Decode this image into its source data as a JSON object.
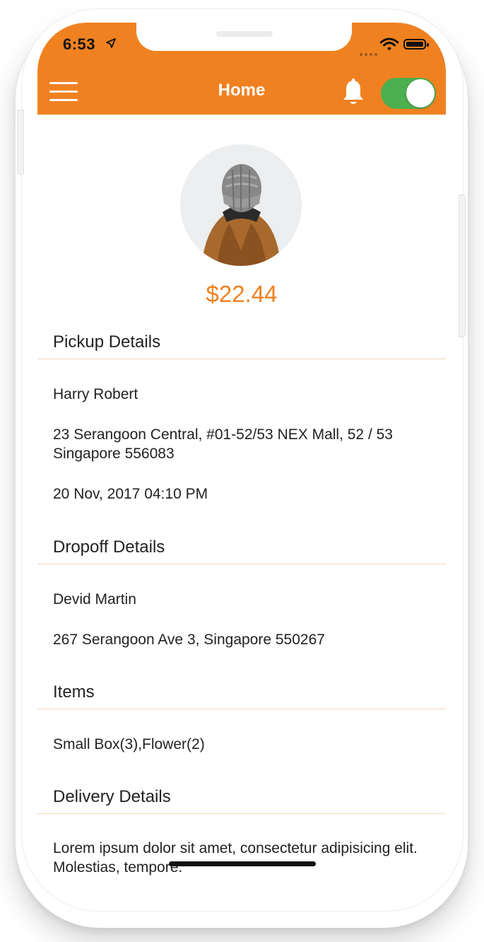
{
  "status_bar": {
    "time": "6:53"
  },
  "header": {
    "title": "Home",
    "toggle_on": true
  },
  "profile": {
    "price": "$22.44"
  },
  "pickup": {
    "heading": "Pickup Details",
    "name": "Harry Robert",
    "address": "23 Serangoon Central, #01-52/53 NEX Mall, 52 / 53 Singapore 556083",
    "datetime": "20 Nov, 2017 04:10 PM"
  },
  "dropoff": {
    "heading": "Dropoff Details",
    "name": "Devid Martin",
    "address": "267 Serangoon Ave 3, Singapore 550267"
  },
  "items": {
    "heading": "Items",
    "list": "Small Box(3),Flower(2)"
  },
  "delivery": {
    "heading": "Delivery Details",
    "text": "Lorem ipsum dolor sit amet, consectetur adipisicing elit. Molestias, tempore."
  },
  "colors": {
    "accent": "#f08121",
    "toggle": "#4caf50",
    "divider": "#f6d9bb"
  },
  "icons": {
    "menu": "hamburger-icon",
    "notifications": "bell-icon",
    "location": "location-arrow-icon",
    "wifi": "wifi-icon",
    "battery": "battery-icon"
  }
}
